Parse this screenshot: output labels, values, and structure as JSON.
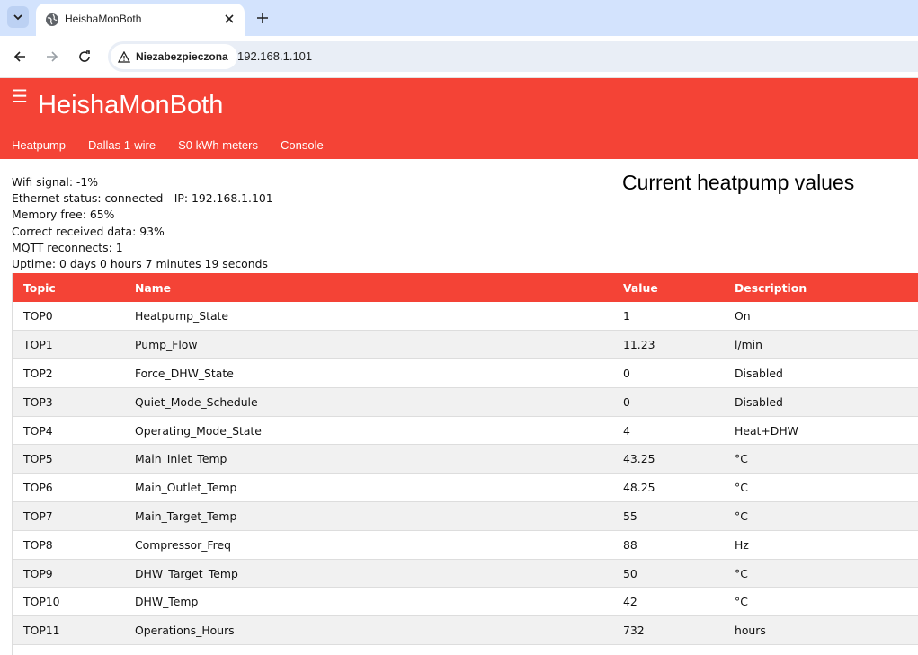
{
  "browser": {
    "tab_title": "HeishaMonBoth",
    "security_label": "Niezabezpieczona",
    "url": "192.168.1.101"
  },
  "app": {
    "title": "HeishaMonBoth",
    "nav": [
      "Heatpump",
      "Dallas 1-wire",
      "S0 kWh meters",
      "Console"
    ]
  },
  "stats": {
    "wifi": "Wifi signal: -1%",
    "ethernet": "Ethernet status: connected - IP: 192.168.1.101",
    "memory": "Memory free: 65%",
    "received": "Correct received data: 93%",
    "mqtt": "MQTT reconnects: 1",
    "uptime": "Uptime: 0 days 0 hours 7 minutes 19 seconds"
  },
  "section_title": "Current heatpump values",
  "table": {
    "headers": [
      "Topic",
      "Name",
      "Value",
      "Description"
    ],
    "rows": [
      [
        "TOP0",
        "Heatpump_State",
        "1",
        "On"
      ],
      [
        "TOP1",
        "Pump_Flow",
        "11.23",
        "l/min"
      ],
      [
        "TOP2",
        "Force_DHW_State",
        "0",
        "Disabled"
      ],
      [
        "TOP3",
        "Quiet_Mode_Schedule",
        "0",
        "Disabled"
      ],
      [
        "TOP4",
        "Operating_Mode_State",
        "4",
        "Heat+DHW"
      ],
      [
        "TOP5",
        "Main_Inlet_Temp",
        "43.25",
        "°C"
      ],
      [
        "TOP6",
        "Main_Outlet_Temp",
        "48.25",
        "°C"
      ],
      [
        "TOP7",
        "Main_Target_Temp",
        "55",
        "°C"
      ],
      [
        "TOP8",
        "Compressor_Freq",
        "88",
        "Hz"
      ],
      [
        "TOP9",
        "DHW_Target_Temp",
        "50",
        "°C"
      ],
      [
        "TOP10",
        "DHW_Temp",
        "42",
        "°C"
      ],
      [
        "TOP11",
        "Operations_Hours",
        "732",
        "hours"
      ]
    ]
  }
}
